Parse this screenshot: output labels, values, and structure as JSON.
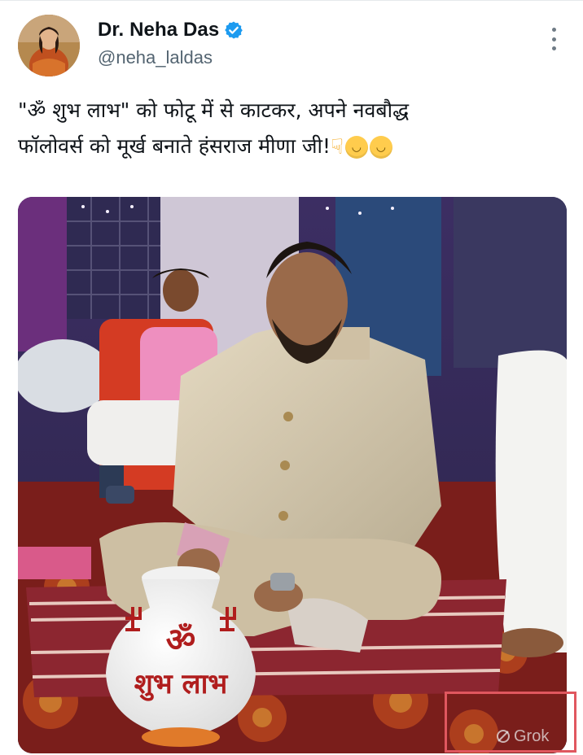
{
  "post": {
    "author": {
      "display_name": "Dr. Neha Das",
      "handle": "@neha_laldas",
      "verified": true
    },
    "text": {
      "line1": "\"ॐ शुभ लाभ\" को फोटू में से काटकर, अपने नवबौद्ध",
      "line2": "फॉलोवर्स को मूर्ख बनाते हंसराज मीणा जी!"
    },
    "emojis": [
      "backhand-index-pointing-down",
      "face-with-tears-of-joy",
      "face-with-tears-of-joy"
    ],
    "media": {
      "pot_symbol": "ॐ",
      "pot_text": "शुभ लाभ",
      "watermark": "Grok"
    }
  },
  "colors": {
    "verified_blue": "#1d9bf0",
    "annotation_red": "#e0575f",
    "text_secondary": "#536471"
  }
}
